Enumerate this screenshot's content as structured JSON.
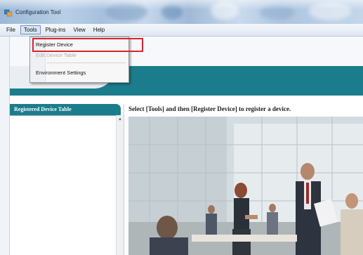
{
  "window": {
    "title": "Configuration Tool",
    "icon": "app-icon"
  },
  "menubar": {
    "items": [
      {
        "label": "File",
        "active": false
      },
      {
        "label": "Tools",
        "active": true
      },
      {
        "label": "Plug-ins",
        "active": false
      },
      {
        "label": "View",
        "active": false
      },
      {
        "label": "Help",
        "active": false
      }
    ]
  },
  "tools_menu": {
    "items": [
      {
        "label": "Register Device",
        "enabled": true,
        "highlighted": true
      },
      {
        "label": "Edit Device Table",
        "enabled": false
      },
      {
        "label": "Environment Settings",
        "enabled": true
      }
    ]
  },
  "side_panel": {
    "title": "Registered Device Table"
  },
  "main": {
    "instruction": "Select [Tools] and then [Register Device] to register a device.",
    "image": "office-people-photo"
  },
  "colors": {
    "accent_teal": "#1b7d8c",
    "highlight_red": "#d9232f"
  }
}
